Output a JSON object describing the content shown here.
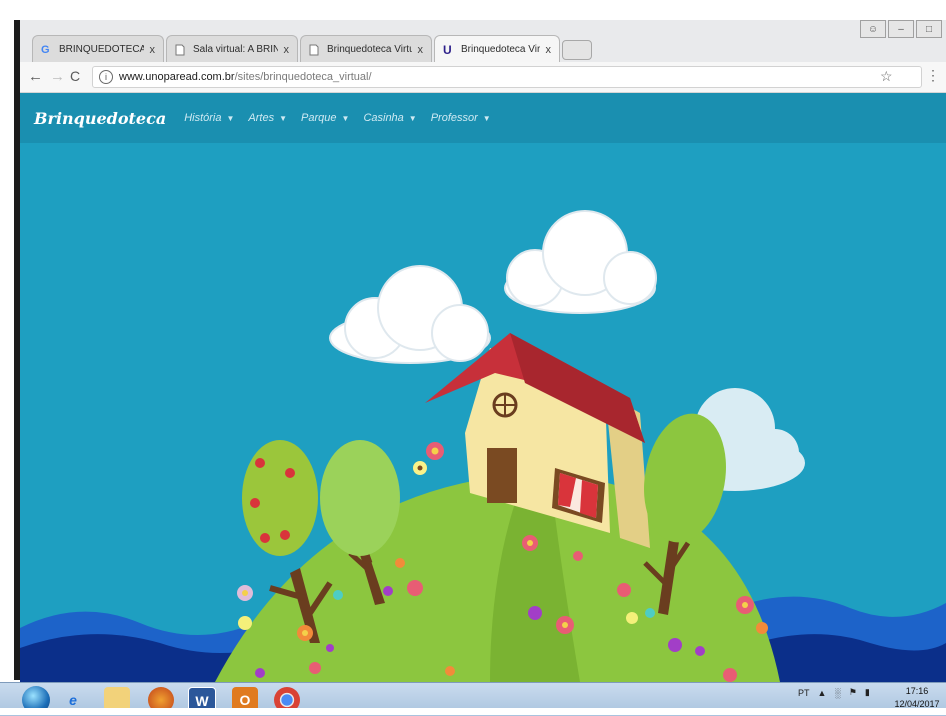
{
  "browser": {
    "tabs": [
      {
        "title": "BRINQUEDOTECA VIRTU",
        "icon": "google-g-icon",
        "active": false
      },
      {
        "title": "Sala virtual: A BRINQUED",
        "icon": "page-icon",
        "active": false
      },
      {
        "title": "Brinquedoteca Virtual U",
        "icon": "page-icon",
        "active": false
      },
      {
        "title": "Brinquedoteca Virtual",
        "icon": "unopar-u-icon",
        "active": true
      }
    ],
    "tab_close": "x",
    "url_domain": "www.unoparead.com.br",
    "url_path": "/sites/brinquedoteca_virtual/"
  },
  "site": {
    "brand": "Brinquedoteca",
    "nav": [
      "História",
      "Artes",
      "Parque",
      "Casinha",
      "Professor"
    ],
    "colors": {
      "sky": "#1e9fc1",
      "nav": "#1a8fb0",
      "hill": "#8cc63f",
      "roof": "#c7303a",
      "wall": "#f6e6a3",
      "wave": "#1d63c9"
    }
  },
  "taskbar": {
    "lang": "PT",
    "time": "17:16",
    "date": "12/04/2017",
    "apps": [
      "start-orb",
      "ie-icon",
      "explorer-icon",
      "firefox-icon",
      "word-icon",
      "outlook-icon",
      "chrome-icon"
    ]
  }
}
